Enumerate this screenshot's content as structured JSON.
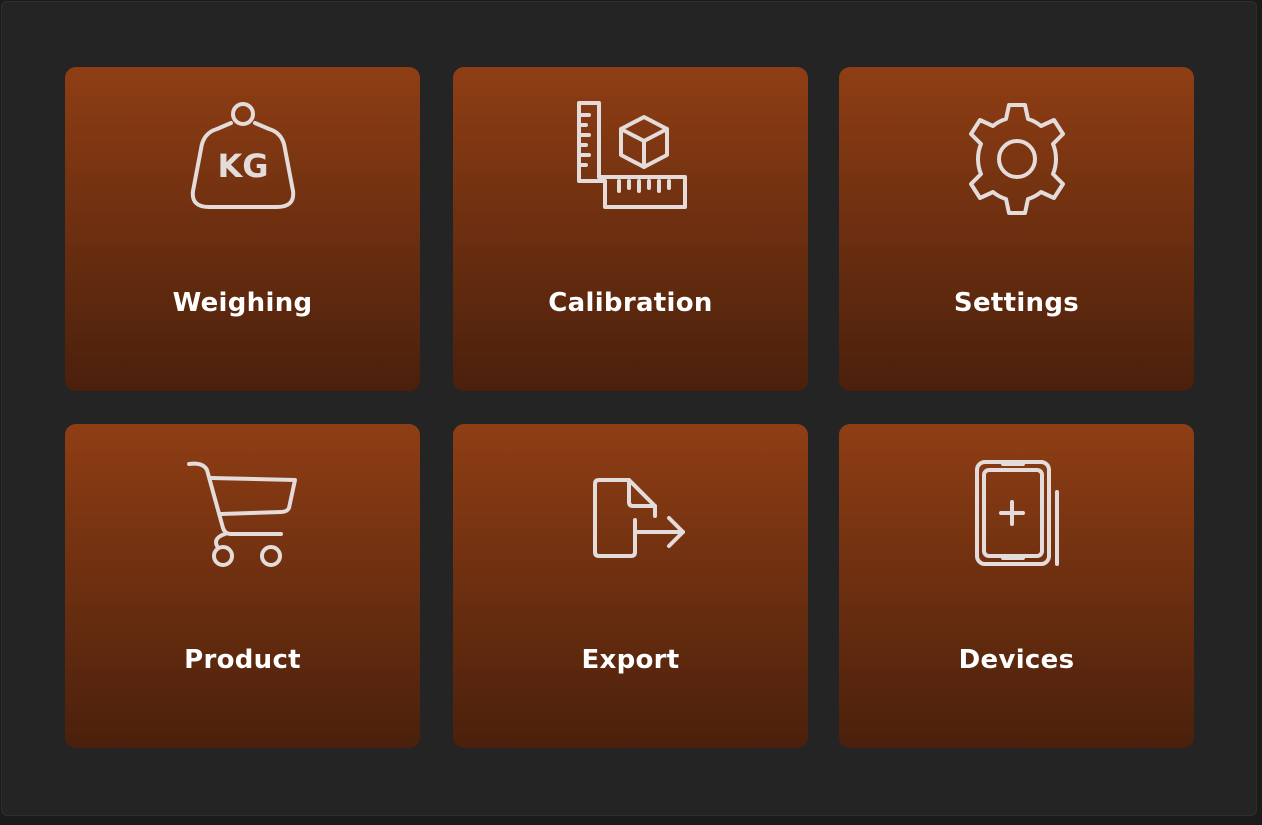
{
  "colors": {
    "tile_top": "#8f3e14",
    "tile_bottom": "#4a200c",
    "background": "#242424",
    "icon_stroke": "#e3dcda"
  },
  "tiles": [
    {
      "label": "Weighing",
      "icon": "weight-kg-icon",
      "icon_text": "KG"
    },
    {
      "label": "Calibration",
      "icon": "ruler-box-icon"
    },
    {
      "label": "Settings",
      "icon": "gear-icon"
    },
    {
      "label": "Product",
      "icon": "shopping-cart-icon"
    },
    {
      "label": "Export",
      "icon": "file-export-icon"
    },
    {
      "label": "Devices",
      "icon": "tablet-add-icon"
    }
  ]
}
